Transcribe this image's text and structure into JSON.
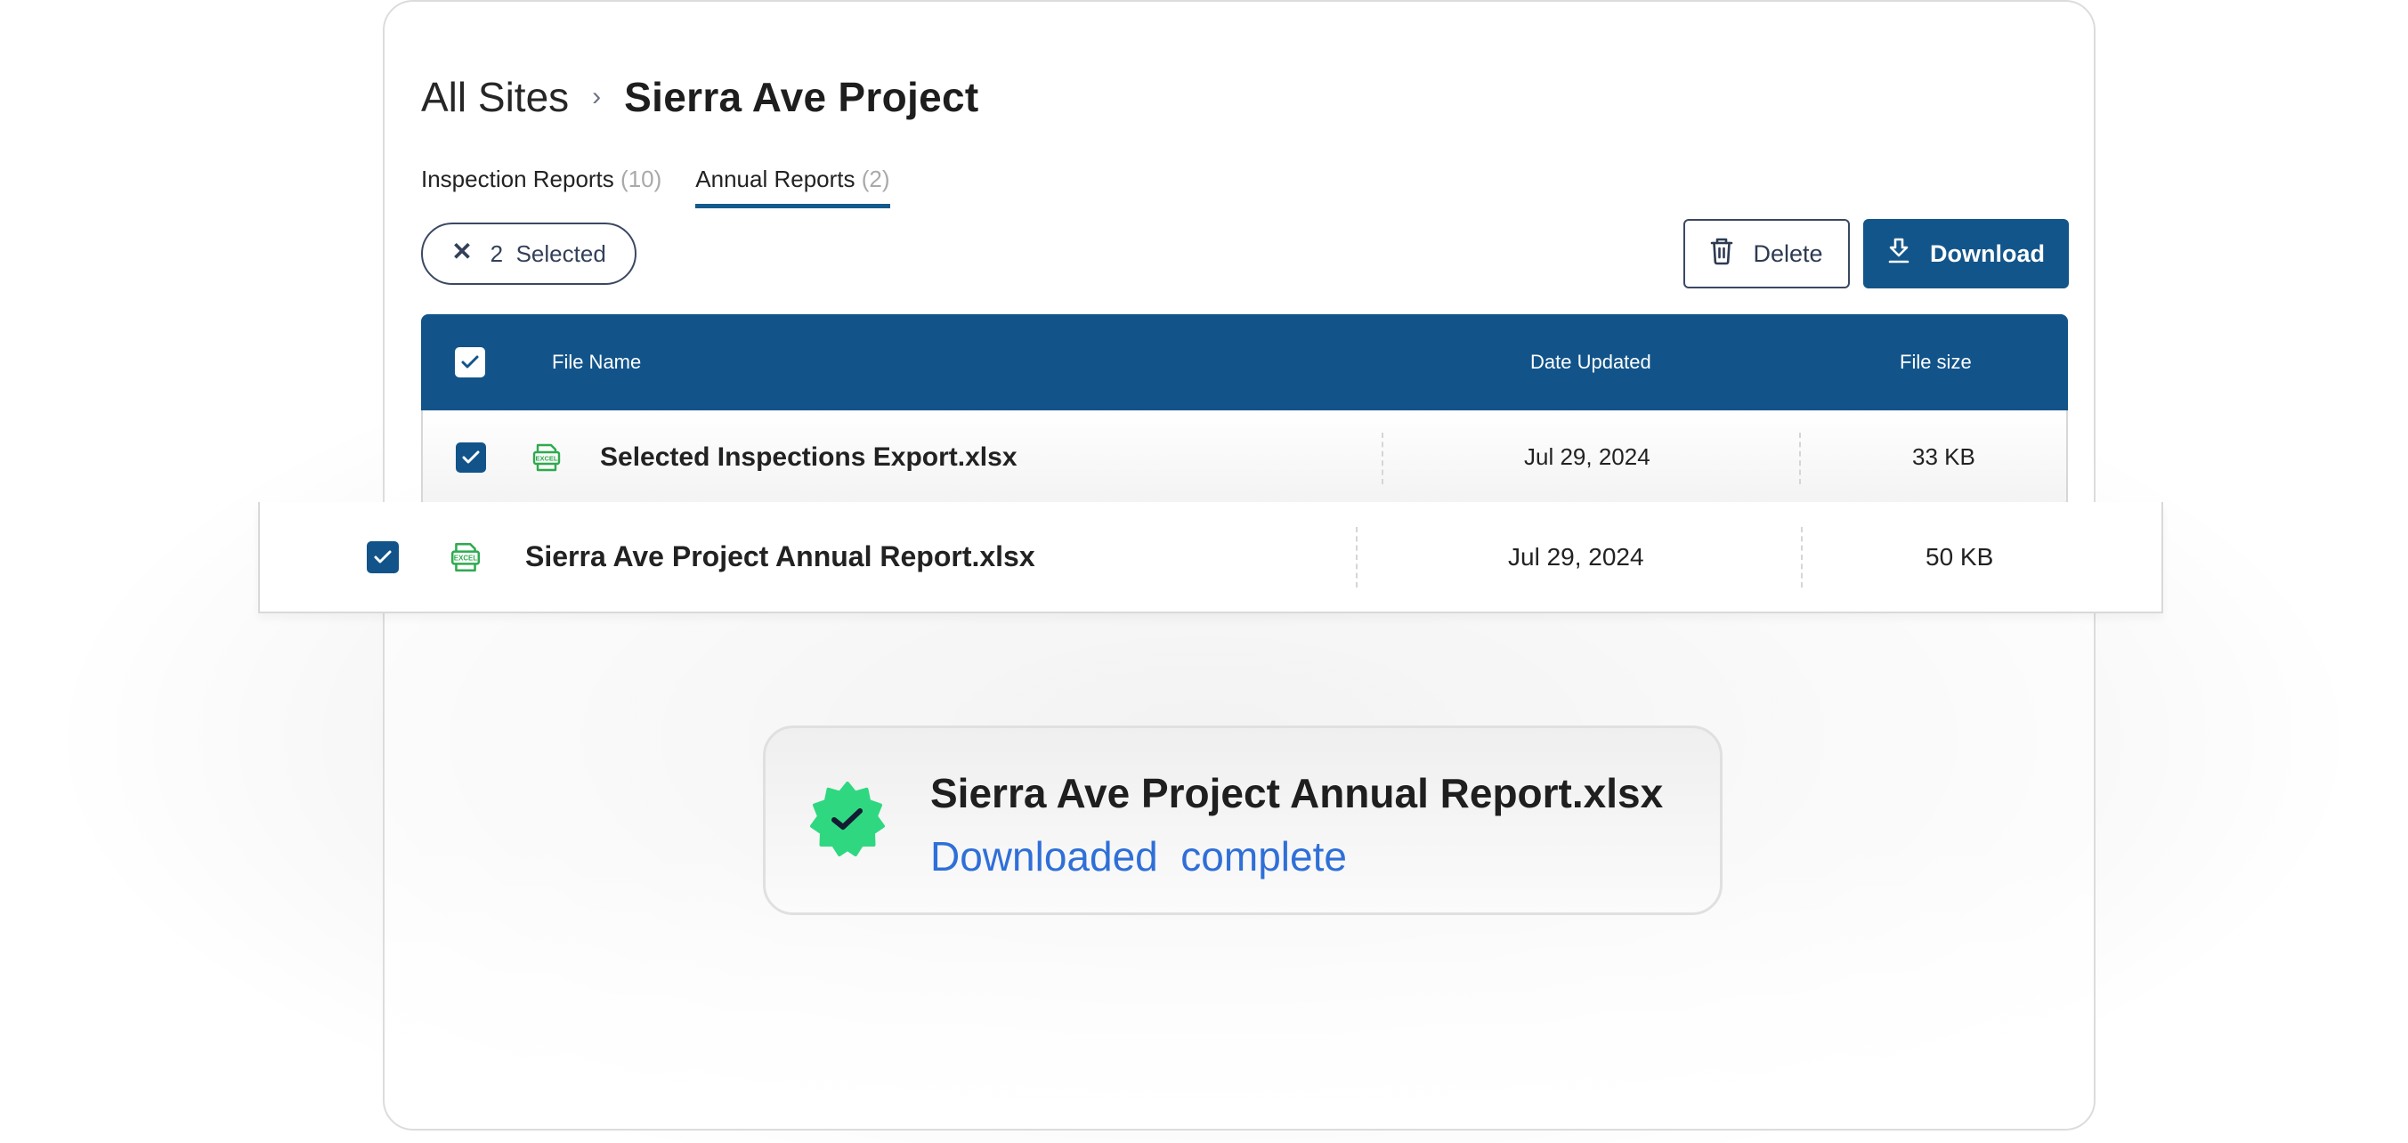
{
  "breadcrumb": {
    "root": "All Sites",
    "separator": "›",
    "current": "Sierra Ave Project"
  },
  "tabs": [
    {
      "label": "Inspection Reports",
      "count": "(10)",
      "active": false
    },
    {
      "label": "Annual Reports",
      "count": "(2)",
      "active": true
    }
  ],
  "selection": {
    "count": "2",
    "label": "Selected",
    "clear_icon": "close-icon"
  },
  "toolbar": {
    "delete_label": "Delete",
    "delete_icon": "trash-icon",
    "download_label": "Download",
    "download_icon": "download-icon"
  },
  "table": {
    "columns": [
      "File Name",
      "Date Updated",
      "File size"
    ],
    "header_checked": true,
    "rows": [
      {
        "name": "Selected Inspections Export.xlsx",
        "date": "Jul 29, 2024",
        "size": "33 KB",
        "checked": true,
        "file_icon": "excel-file-icon",
        "file_icon_text": "EXCEL"
      },
      {
        "name": "Sierra Ave Project Annual Report.xlsx",
        "date": "Jul 29, 2024",
        "size": "50 KB",
        "checked": true,
        "file_icon": "excel-file-icon",
        "file_icon_text": "EXCEL"
      }
    ]
  },
  "toast": {
    "title": "Sierra Ave Project Annual Report.xlsx",
    "status": "Downloaded  complete",
    "icon": "verified-badge-icon"
  },
  "colors": {
    "primary": "#12548a",
    "excel_green": "#2eaa4f",
    "badge_green": "#2fd880",
    "status_blue": "#2f6fd8"
  }
}
